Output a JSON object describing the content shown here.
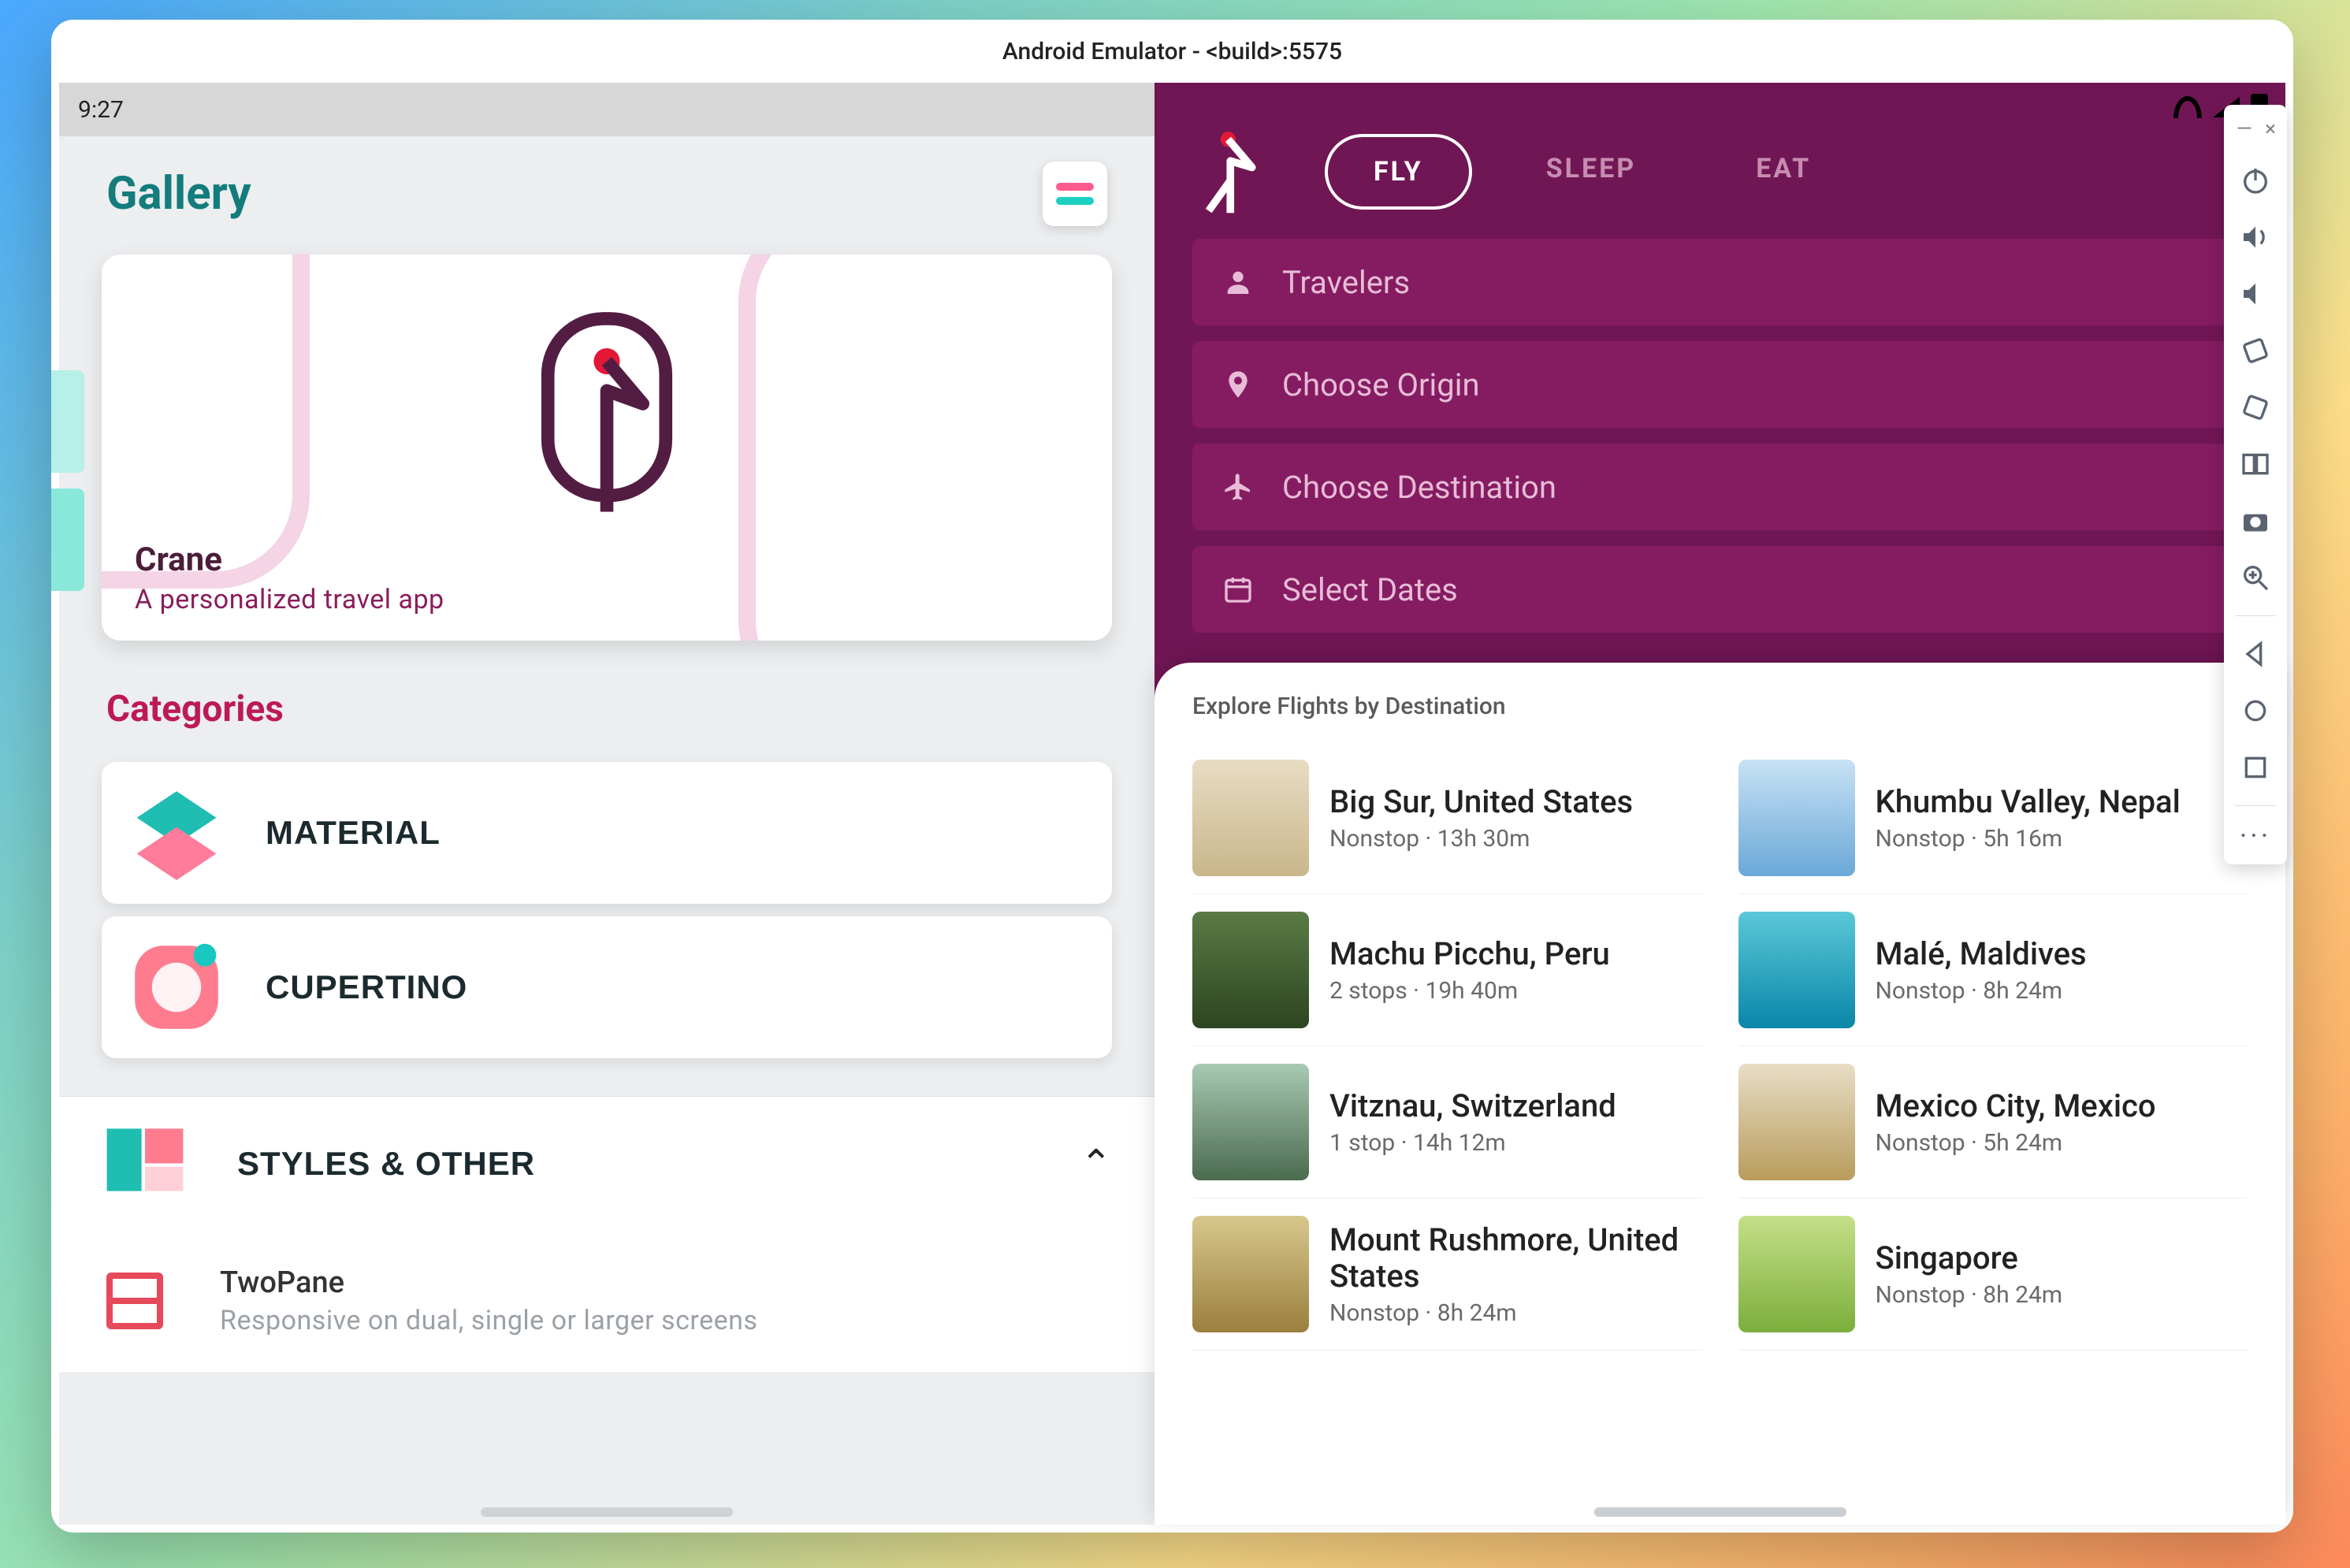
{
  "window_title": "Android Emulator - <build>:5575",
  "left": {
    "clock": "9:27",
    "title": "Gallery",
    "featured": {
      "name": "Crane",
      "tagline": "A personalized travel app"
    },
    "categories_heading": "Categories",
    "categories": [
      {
        "label": "MATERIAL"
      },
      {
        "label": "CUPERTINO"
      }
    ],
    "styles": {
      "label": "STYLES & OTHER"
    },
    "subitem": {
      "title": "TwoPane",
      "desc": "Responsive on dual, single or larger screens"
    }
  },
  "right": {
    "tabs": {
      "fly": "FLY",
      "sleep": "SLEEP",
      "eat": "EAT"
    },
    "search": {
      "travelers": "Travelers",
      "origin": "Choose Origin",
      "destination": "Choose Destination",
      "dates": "Select Dates"
    },
    "sheet_title": "Explore Flights by Destination",
    "destinations": [
      {
        "name": "Big Sur, United States",
        "meta": "Nonstop · 13h 30m"
      },
      {
        "name": "Khumbu Valley, Nepal",
        "meta": "Nonstop · 5h 16m"
      },
      {
        "name": "Machu Picchu, Peru",
        "meta": "2 stops · 19h 40m"
      },
      {
        "name": "Malé, Maldives",
        "meta": "Nonstop · 8h 24m"
      },
      {
        "name": "Vitznau, Switzerland",
        "meta": "1 stop · 14h 12m"
      },
      {
        "name": "Mexico City, Mexico",
        "meta": "Nonstop · 5h 24m"
      },
      {
        "name": "Mount Rushmore, United States",
        "meta": "Nonstop · 8h 24m"
      },
      {
        "name": "Singapore",
        "meta": "Nonstop · 8h 24m"
      }
    ]
  }
}
